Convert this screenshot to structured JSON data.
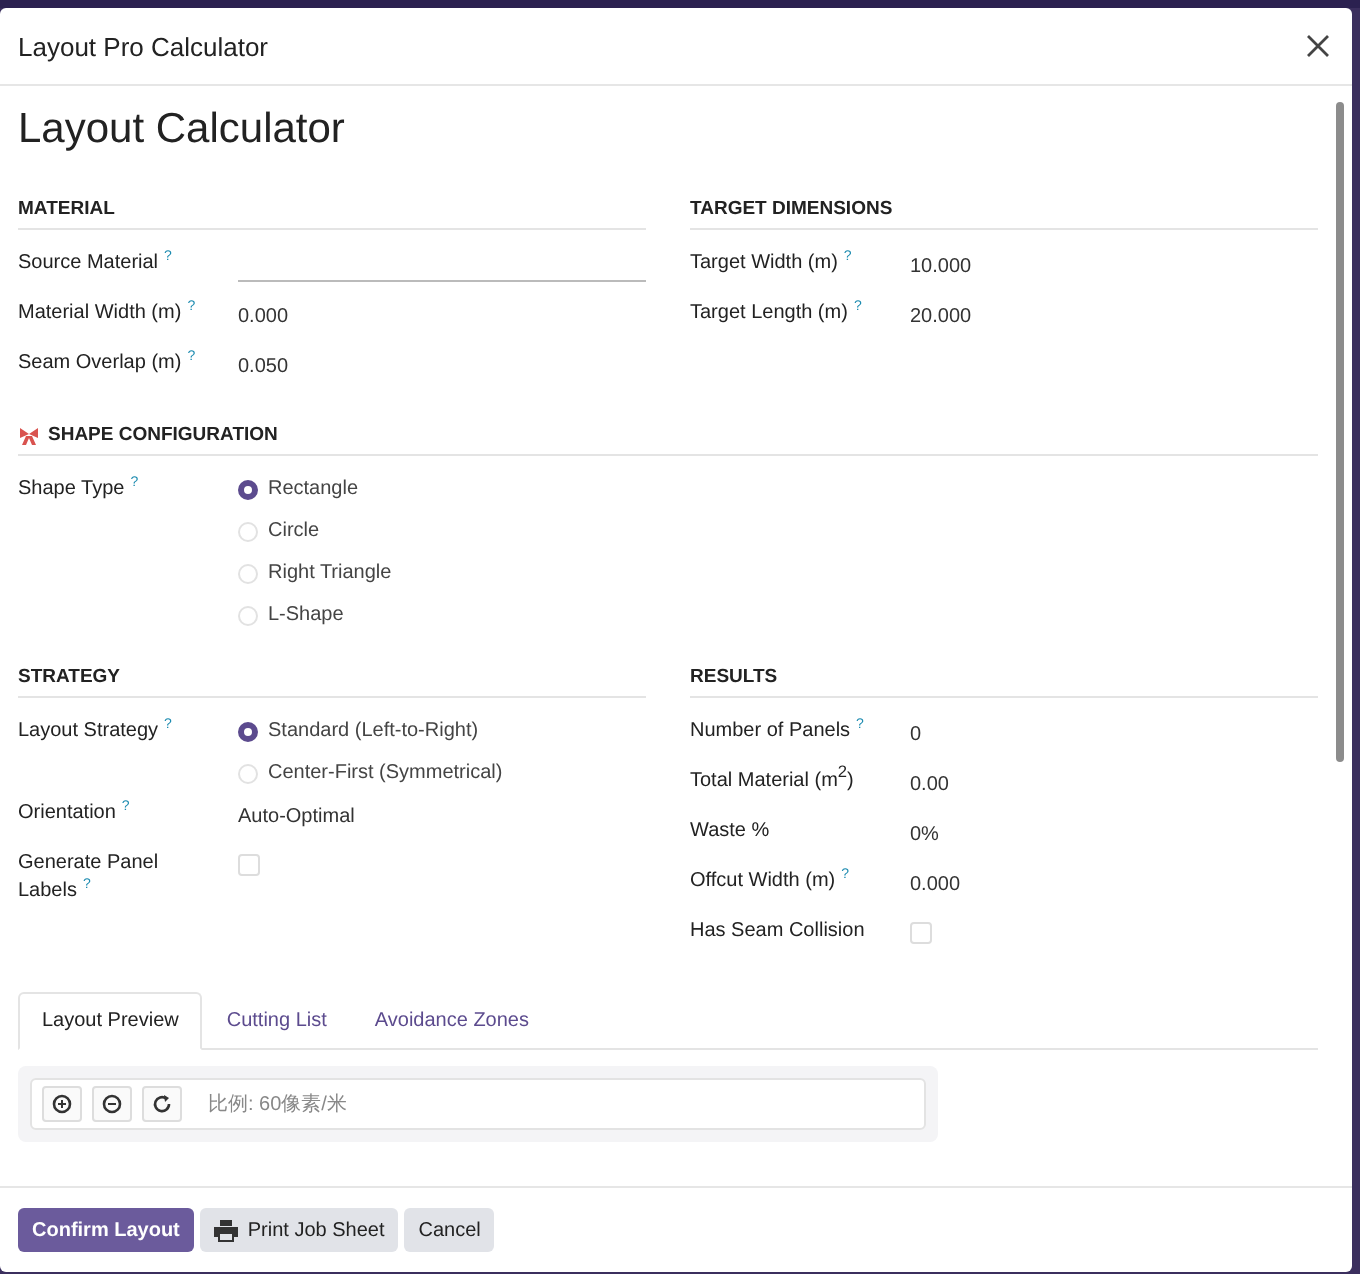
{
  "dialog": {
    "title": "Layout Pro Calculator",
    "heading": "Layout Calculator"
  },
  "rows": [
    [
      {
        "title": "MATERIAL",
        "decorated": false,
        "fields": [
          {
            "label": "Source Material",
            "help": "?",
            "kind": "input"
          },
          {
            "label": "Material Width (m)",
            "help": "?",
            "kind": "value",
            "value": "0.000"
          },
          {
            "label": "Seam Overlap (m)",
            "help": "?",
            "kind": "value",
            "value": "0.050"
          }
        ]
      },
      {
        "title": "TARGET DIMENSIONS",
        "decorated": false,
        "fields": [
          {
            "label": "Target Width (m)",
            "help": "?",
            "kind": "value",
            "value": "10.000"
          },
          {
            "label": "Target Length (m)",
            "help": "?",
            "kind": "value",
            "value": "20.000"
          }
        ]
      }
    ],
    [
      {
        "title": "SHAPE CONFIGURATION",
        "decorated": true,
        "fields": [
          {
            "label": "Shape Type",
            "help": "?",
            "kind": "radio",
            "options": [
              {
                "label": "Rectangle",
                "selected": true
              },
              {
                "label": "Circle",
                "selected": false
              },
              {
                "label": "Right Triangle",
                "selected": false
              },
              {
                "label": "L-Shape",
                "selected": false
              }
            ]
          }
        ]
      }
    ],
    [
      {
        "title": "STRATEGY",
        "decorated": false,
        "fields": [
          {
            "label": "Layout Strategy",
            "help": "?",
            "kind": "radio",
            "options": [
              {
                "label": "Standard (Left-to-Right)",
                "selected": true
              },
              {
                "label": "Center-First (Symmetrical)",
                "selected": false
              }
            ]
          },
          {
            "label": "Orientation",
            "help": "?",
            "kind": "value",
            "value": "Auto-Optimal"
          },
          {
            "label": "Generate Panel Labels",
            "help": "?",
            "kind": "checkbox",
            "checked": false
          }
        ]
      },
      {
        "title": "RESULTS",
        "decorated": false,
        "fields": [
          {
            "label": "Number of Panels",
            "help": "?",
            "kind": "value",
            "value": "0"
          },
          {
            "label": "Total Material (m$^{2}$)",
            "kind": "value",
            "value": "0.00"
          },
          {
            "label": "Waste %",
            "kind": "value",
            "value": "0%"
          },
          {
            "label": "Offcut Width (m)",
            "help": "?",
            "kind": "value",
            "value": "0.000"
          },
          {
            "label": "Has Seam Collision",
            "kind": "checkbox",
            "checked": false
          }
        ]
      }
    ]
  ],
  "tabs": [
    {
      "label": "Layout Preview",
      "selected": true
    },
    {
      "label": "Cutting List",
      "selected": false
    },
    {
      "label": "Avoidance Zones",
      "selected": false
    }
  ],
  "preview": {
    "scale": "比例: 60像素/米"
  },
  "buttons": [
    {
      "label": "Confirm Layout",
      "kind": "primary"
    },
    {
      "label": "Print Job Sheet",
      "kind": "print"
    },
    {
      "label": "Cancel",
      "kind": "secondary"
    }
  ]
}
